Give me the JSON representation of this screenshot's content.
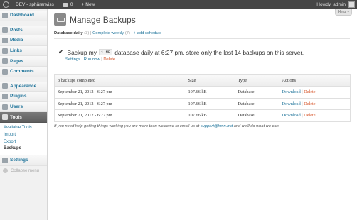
{
  "admin_bar": {
    "site_name": "DEV - sphärenviss",
    "comments_count": "0",
    "new_label": "New",
    "howdy": "Howdy, admin"
  },
  "sidebar": {
    "items": [
      {
        "label": "Dashboard",
        "icon": "dashboard-icon"
      },
      {
        "label": "Posts",
        "icon": "posts-icon"
      },
      {
        "label": "Media",
        "icon": "media-icon"
      },
      {
        "label": "Links",
        "icon": "links-icon"
      },
      {
        "label": "Pages",
        "icon": "pages-icon"
      },
      {
        "label": "Comments",
        "icon": "comments-icon"
      },
      {
        "label": "Appearance",
        "icon": "appearance-icon"
      },
      {
        "label": "Plugins",
        "icon": "plugins-icon"
      },
      {
        "label": "Users",
        "icon": "users-icon"
      },
      {
        "label": "Tools",
        "icon": "tools-icon",
        "active": true
      },
      {
        "label": "Settings",
        "icon": "settings-icon"
      }
    ],
    "tools_submenu": [
      "Available Tools",
      "Import",
      "Export",
      "Backups"
    ],
    "collapse_label": "Collapse menu"
  },
  "help_label": "Help",
  "page_title": "Manage Backups",
  "tabs": {
    "current": {
      "label": "Database daily",
      "count": "(3)"
    },
    "other": {
      "label": "Complete weekly",
      "count": "(7)"
    },
    "add": "+ add schedule"
  },
  "schedule": {
    "prefix": "Backup my",
    "code": "1 MB",
    "suffix": "database daily at 6:27 pm, store only the last 14 backups on this server.",
    "links": {
      "settings": "Settings",
      "run_now": "Run now",
      "delete": "Delete"
    }
  },
  "table": {
    "headers": [
      "3 backups completed",
      "Size",
      "Type",
      "Actions"
    ],
    "rows": [
      {
        "date": "September 21, 2012 - 6:27 pm",
        "size": "107.66 kB",
        "type": "Database"
      },
      {
        "date": "September 21, 2012 - 6:27 pm",
        "size": "107.66 kB",
        "type": "Database"
      },
      {
        "date": "September 21, 2012 - 6:27 pm",
        "size": "107.66 kB",
        "type": "Database"
      }
    ],
    "download_label": "Download",
    "delete_label": "Delete"
  },
  "footer": {
    "before": "If you need help getting things working you are more than welcome to email us at",
    "email": "support@hmn.md",
    "after": "and we'll do what we can."
  },
  "colors": {
    "link": "#21759b",
    "delete": "#d54e21",
    "admin_bar": "#464646",
    "active_menu": "#6d6d6d"
  }
}
